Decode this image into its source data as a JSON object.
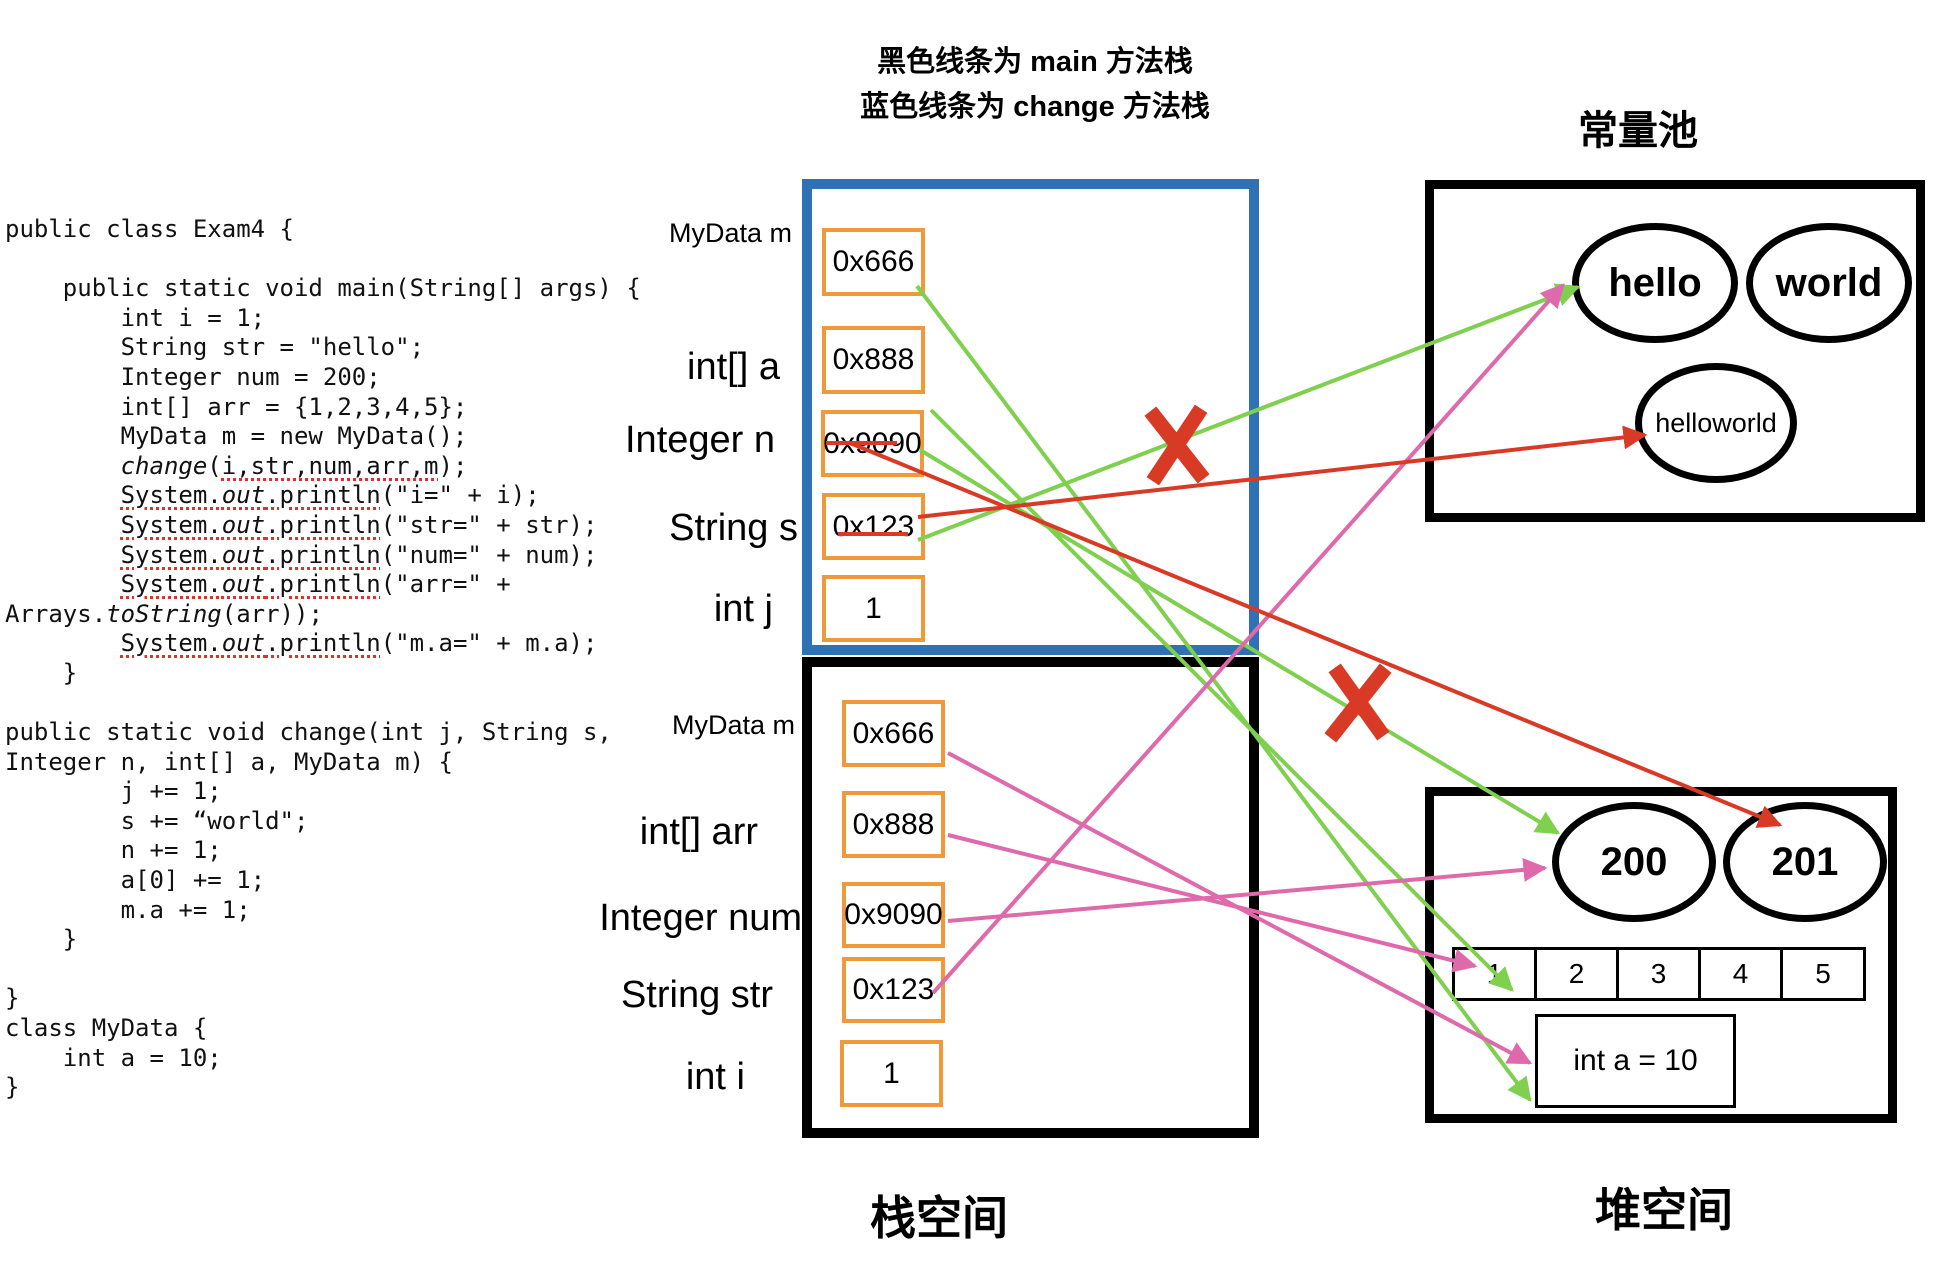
{
  "legend": {
    "line1": "黑色线条为 main 方法栈",
    "line2": "蓝色线条为 change 方法栈"
  },
  "titles": {
    "constant_pool": "常量池",
    "stack_space": "栈空间",
    "heap_space": "堆空间"
  },
  "code_lines": [
    {
      "t": "public class Exam4 {"
    },
    {
      "t": ""
    },
    {
      "t": "    public static void main(String[] args) {"
    },
    {
      "t": "        int i = 1;"
    },
    {
      "t": "        String str = \"hello\";"
    },
    {
      "t": "        Integer num = 200;"
    },
    {
      "t": "        int[] arr = {1,2,3,4,5};"
    },
    {
      "t": "        MyData m = new MyData();"
    },
    {
      "t": "        change(i,str,num,arr,m);"
    },
    {
      "t": "        System.out.println(\"i=\" + i);"
    },
    {
      "t": "        System.out.println(\"str=\" + str);"
    },
    {
      "t": "        System.out.println(\"num=\" + num);"
    },
    {
      "t": "        System.out.println(\"arr=\" +"
    },
    {
      "t": "Arrays.toString(arr));"
    },
    {
      "t": "        System.out.println(\"m.a=\" + m.a);"
    },
    {
      "t": "    }"
    },
    {
      "t": ""
    },
    {
      "t": "public static void change(int j, String s,"
    },
    {
      "t": "Integer n, int[] a, MyData m) {"
    },
    {
      "t": "        j += 1;"
    },
    {
      "t": "        s += “world\";"
    },
    {
      "t": "        n += 1;"
    },
    {
      "t": "        a[0] += 1;"
    },
    {
      "t": "        m.a += 1;"
    },
    {
      "t": "    }"
    },
    {
      "t": ""
    },
    {
      "t": "}"
    },
    {
      "t": "class MyData {"
    },
    {
      "t": "    int a = 10;"
    },
    {
      "t": "}"
    }
  ],
  "change_frame": {
    "slots": [
      {
        "label": "MyData  m",
        "value": "0x666",
        "struck": false
      },
      {
        "label": "int[] a",
        "value": "0x888",
        "struck": false
      },
      {
        "label": "Integer n",
        "value": "0x9090",
        "struck": true
      },
      {
        "label": "String s",
        "value": "0x123",
        "struck": true
      },
      {
        "label": "int j",
        "value": "1",
        "struck": false
      }
    ]
  },
  "main_frame": {
    "slots": [
      {
        "label": "MyData  m",
        "value": "0x666"
      },
      {
        "label": "int[] arr",
        "value": "0x888"
      },
      {
        "label": "Integer num",
        "value": "0x9090"
      },
      {
        "label": "String str",
        "value": "0x123"
      },
      {
        "label": "int i",
        "value": "1"
      }
    ]
  },
  "constant_pool": {
    "strings": [
      "hello",
      "world",
      "helloworld"
    ]
  },
  "heap": {
    "integers": [
      "200",
      "201"
    ],
    "array": [
      "1",
      "2",
      "3",
      "4",
      "5"
    ],
    "object_field": "int a = 10"
  },
  "colors": {
    "change_frame": "#2e72b5",
    "main_frame": "#000000",
    "slot_border": "#f0993a",
    "change_refs": "#7ed04e",
    "main_refs": "#de6aab",
    "reassigned_refs": "#d93a26",
    "invalidated_mark": "#d93a26"
  },
  "references": [
    {
      "from": "change.m",
      "to": "heap.object",
      "color": "green"
    },
    {
      "from": "change.a",
      "to": "heap.array",
      "color": "green"
    },
    {
      "from": "change.n",
      "to": "heap.200",
      "color": "green",
      "crossed_out": true
    },
    {
      "from": "change.s",
      "to": "pool.hello",
      "color": "green",
      "crossed_out": true
    },
    {
      "from": "change.n",
      "to": "heap.201",
      "color": "red"
    },
    {
      "from": "change.s",
      "to": "pool.helloworld",
      "color": "red"
    },
    {
      "from": "main.m",
      "to": "heap.object",
      "color": "pink"
    },
    {
      "from": "main.arr",
      "to": "heap.array",
      "color": "pink"
    },
    {
      "from": "main.num",
      "to": "heap.200",
      "color": "pink"
    },
    {
      "from": "main.str",
      "to": "pool.hello",
      "color": "pink"
    }
  ]
}
